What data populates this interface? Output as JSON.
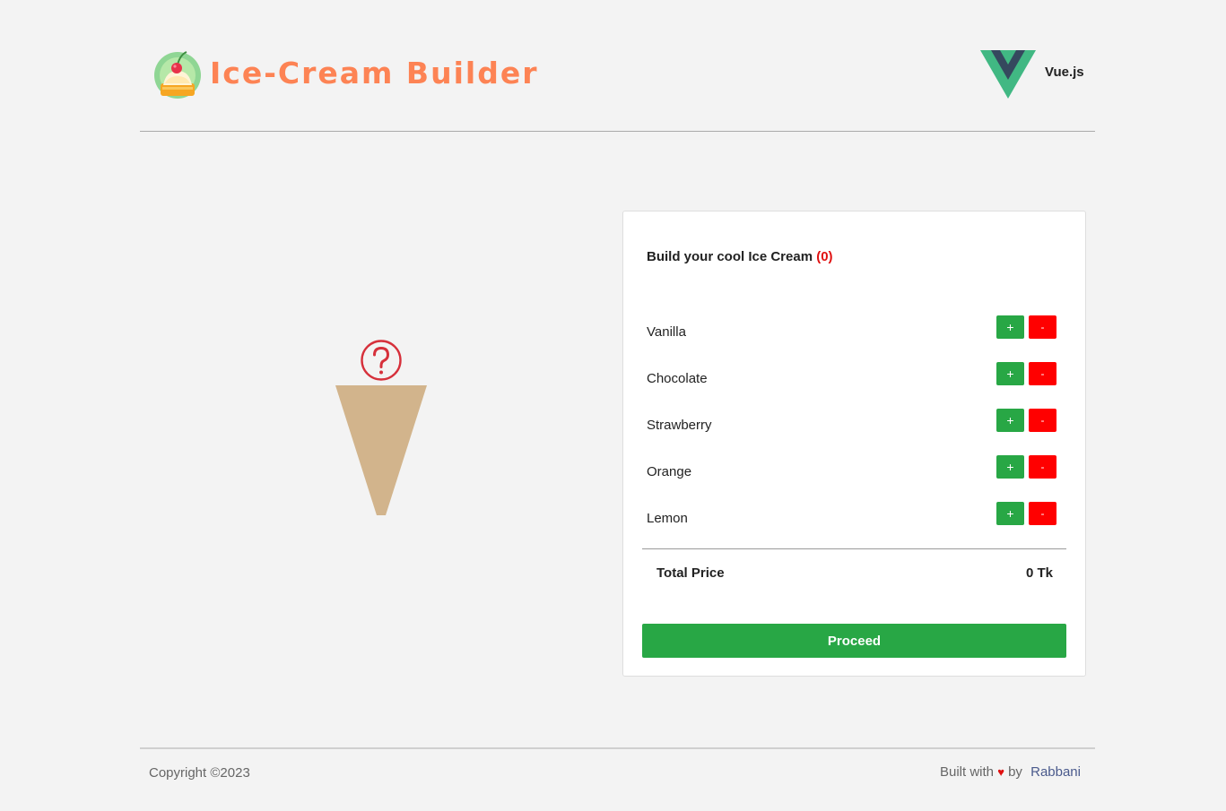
{
  "header": {
    "title": "Ice-Cream Builder",
    "framework_label": "Vue.js",
    "logo_icon": "ice-cream-cherry-icon"
  },
  "preview": {
    "placeholder_icon": "question-mark-icon",
    "cone_color": "#d2b48c"
  },
  "builder": {
    "title": "Build your cool Ice Cream",
    "count": "(0)",
    "flavors": [
      {
        "name": "Vanilla",
        "add_label": "+",
        "remove_label": "-"
      },
      {
        "name": "Chocolate",
        "add_label": "+",
        "remove_label": "-"
      },
      {
        "name": "Strawberry",
        "add_label": "+",
        "remove_label": "-"
      },
      {
        "name": "Orange",
        "add_label": "+",
        "remove_label": "-"
      },
      {
        "name": "Lemon",
        "add_label": "+",
        "remove_label": "-"
      }
    ],
    "total_label": "Total Price",
    "total_value": "0 Tk",
    "proceed_label": "Proceed"
  },
  "footer": {
    "copyright": "Copyright ©2023",
    "built_with": "Built with",
    "by": "by",
    "author": "Rabbani"
  },
  "colors": {
    "brand": "#fd8354",
    "add": "#28a745",
    "remove": "#ff0000",
    "accent_red": "#e01010"
  }
}
